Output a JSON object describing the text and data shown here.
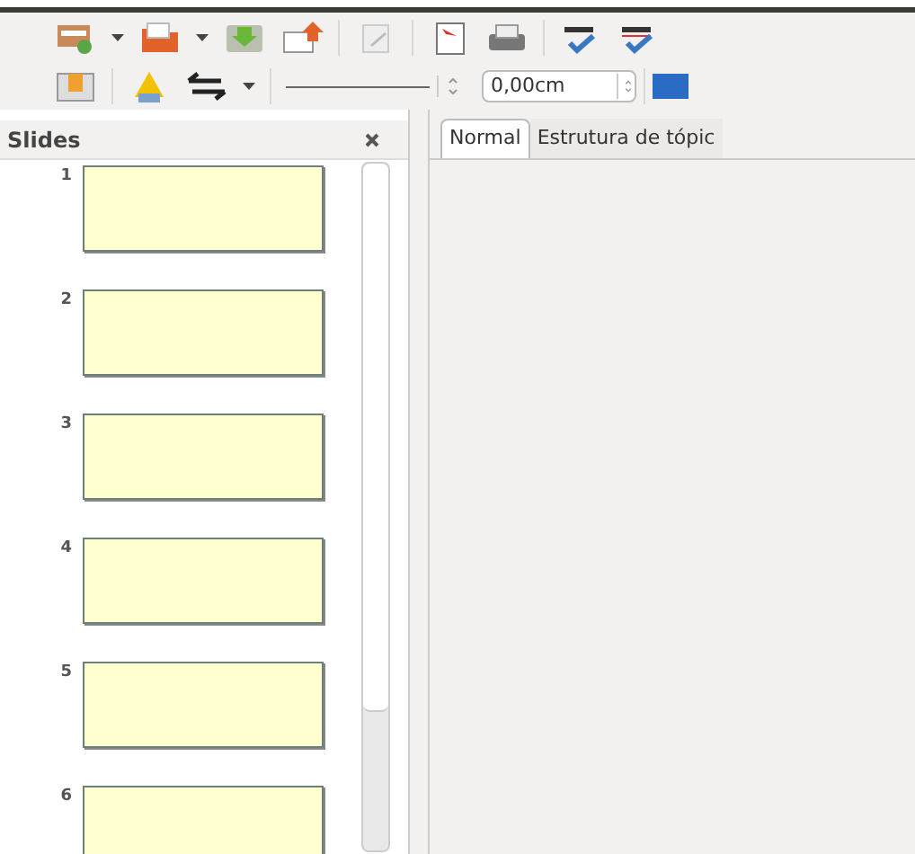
{
  "toolbar": {
    "line_width": {
      "value": "0,00cm"
    }
  },
  "slides_pane": {
    "title": "Slides",
    "slides": [
      {
        "number": "1",
        "selected": false
      },
      {
        "number": "2",
        "selected": false
      },
      {
        "number": "3",
        "selected": false
      },
      {
        "number": "4",
        "selected": false
      },
      {
        "number": "5",
        "selected": false
      },
      {
        "number": "6",
        "selected": false
      }
    ]
  },
  "tabs": [
    {
      "label": "Normal",
      "selected": true
    },
    {
      "label": "Estrutura de tópic",
      "selected": false
    }
  ]
}
